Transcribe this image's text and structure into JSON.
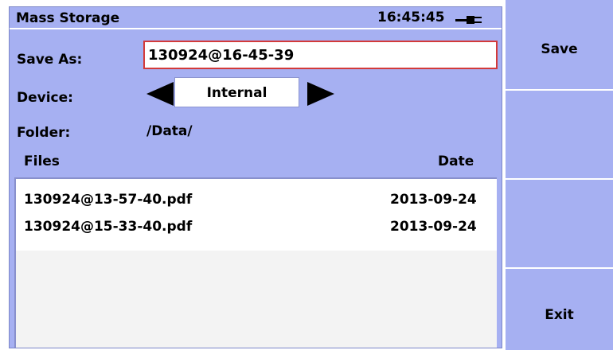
{
  "header": {
    "title": "Mass Storage",
    "time": "16:45:45",
    "power_icon": "ac-plug-icon"
  },
  "form": {
    "save_as_label": "Save As:",
    "filename_value": "130924@16-45-39",
    "device_label": "Device:",
    "device_value": "Internal",
    "folder_label": "Folder:",
    "folder_value": "/Data/"
  },
  "file_list": {
    "columns": [
      "Files",
      "Date"
    ],
    "rows": [
      {
        "name": "130924@13-57-40.pdf",
        "date": "2013-09-24"
      },
      {
        "name": "130924@15-33-40.pdf",
        "date": "2013-09-24"
      }
    ]
  },
  "side_buttons": {
    "save_label": "Save",
    "button2_label": "",
    "button3_label": "",
    "exit_label": "Exit"
  },
  "colors": {
    "panel": "#a6b0f2",
    "input_border_active": "#d33a3a",
    "list_background": "#ffffff"
  }
}
